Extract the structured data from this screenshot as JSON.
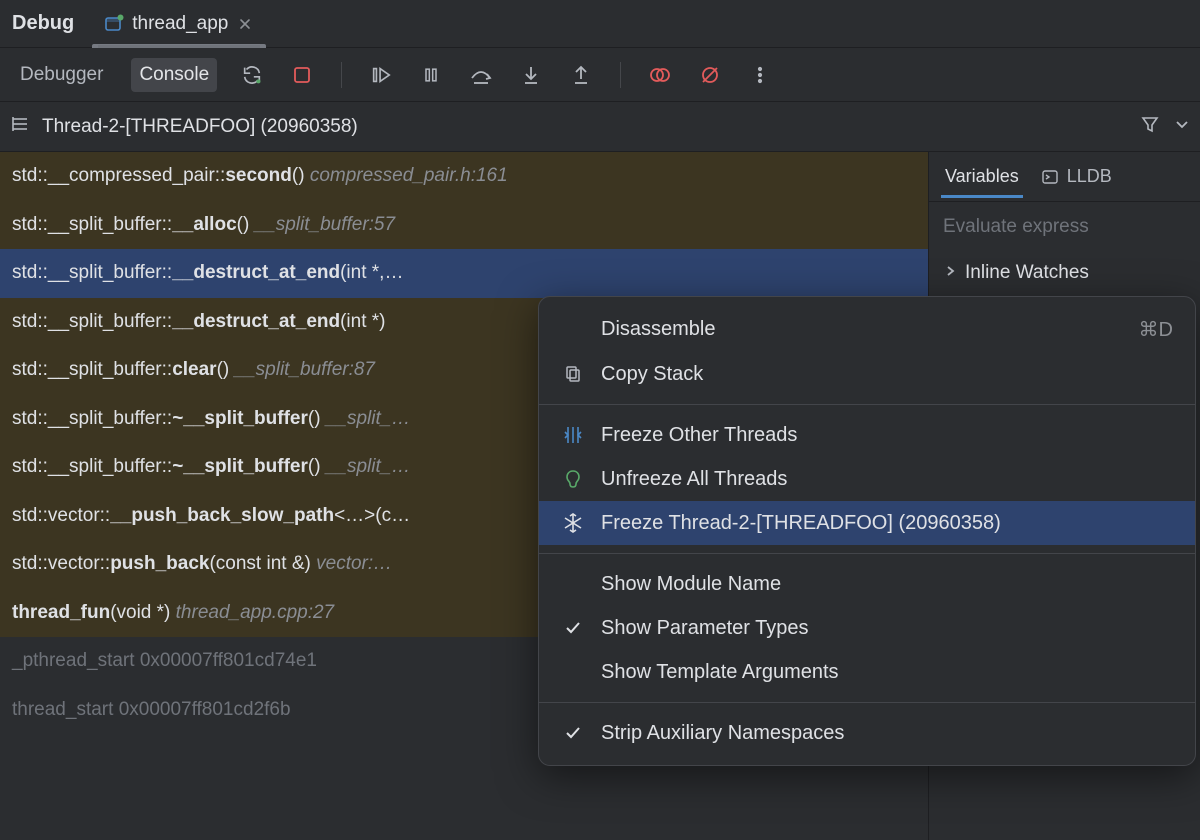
{
  "tabs": {
    "debug_label": "Debug",
    "file_name": "thread_app",
    "close_tooltip": "Close"
  },
  "toolbar": {
    "debugger_label": "Debugger",
    "console_label": "Console"
  },
  "thread_selector": {
    "label": "Thread-2-[THREADFOO] (20960358)"
  },
  "frames": [
    {
      "prefix": "std::__compressed_pair::",
      "fn": "second",
      "args": "()",
      "loc": "compressed_pair.h:161",
      "sys": false,
      "selected": false
    },
    {
      "prefix": "std::__split_buffer::",
      "fn": "__alloc",
      "args": "()",
      "loc": "__split_buffer:57",
      "sys": false,
      "selected": false
    },
    {
      "prefix": "std::__split_buffer::",
      "fn": "__destruct_at_end",
      "args": "(int *,…",
      "loc": "",
      "sys": false,
      "selected": true
    },
    {
      "prefix": "std::__split_buffer::",
      "fn": "__destruct_at_end",
      "args": "(int *)",
      "loc": "",
      "sys": false,
      "selected": false
    },
    {
      "prefix": "std::__split_buffer::",
      "fn": "clear",
      "args": "()",
      "loc": "__split_buffer:87",
      "sys": false,
      "selected": false
    },
    {
      "prefix": "std::__split_buffer::",
      "fn": "~__split_buffer",
      "args": "()",
      "loc": "__split_…",
      "sys": false,
      "selected": false
    },
    {
      "prefix": "std::__split_buffer::",
      "fn": "~__split_buffer",
      "args": "()",
      "loc": "__split_…",
      "sys": false,
      "selected": false
    },
    {
      "prefix": "std::vector::",
      "fn": "__push_back_slow_path",
      "args": "<…>(c…",
      "loc": "",
      "sys": false,
      "selected": false
    },
    {
      "prefix": "std::vector::",
      "fn": "push_back",
      "args": "(const int &)",
      "loc": "vector:…",
      "sys": false,
      "selected": false
    },
    {
      "prefix": "",
      "fn": "thread_fun",
      "args": "(void *)",
      "loc": "thread_app.cpp:27",
      "sys": false,
      "selected": false
    },
    {
      "prefix": "",
      "fn": "_pthread_start",
      "args": "",
      "loc": "0x00007ff801cd74e1",
      "sys": true,
      "selected": false
    },
    {
      "prefix": "",
      "fn": "thread_start",
      "args": "",
      "loc": "0x00007ff801cd2f6b",
      "sys": true,
      "selected": false
    }
  ],
  "vars_panel": {
    "tab_variables": "Variables",
    "tab_lldb": "LLDB",
    "eval_placeholder": "Evaluate express",
    "inline_watches": "Inline Watches"
  },
  "context_menu": {
    "items": [
      {
        "kind": "item",
        "label": "Disassemble",
        "icon": "",
        "shortcut": "⌘D",
        "selected": false
      },
      {
        "kind": "item",
        "label": "Copy Stack",
        "icon": "copy",
        "shortcut": "",
        "selected": false
      },
      {
        "kind": "sep"
      },
      {
        "kind": "item",
        "label": "Freeze Other Threads",
        "icon": "freeze-others",
        "shortcut": "",
        "selected": false
      },
      {
        "kind": "item",
        "label": "Unfreeze All Threads",
        "icon": "unfreeze",
        "shortcut": "",
        "selected": false
      },
      {
        "kind": "item",
        "label": "Freeze Thread-2-[THREADFOO] (20960358)",
        "icon": "snowflake",
        "shortcut": "",
        "selected": true
      },
      {
        "kind": "sep"
      },
      {
        "kind": "item",
        "label": "Show Module Name",
        "icon": "",
        "shortcut": "",
        "selected": false
      },
      {
        "kind": "item",
        "label": "Show Parameter Types",
        "icon": "check",
        "shortcut": "",
        "selected": false
      },
      {
        "kind": "item",
        "label": "Show Template Arguments",
        "icon": "",
        "shortcut": "",
        "selected": false
      },
      {
        "kind": "sep"
      },
      {
        "kind": "item",
        "label": "Strip Auxiliary Namespaces",
        "icon": "check",
        "shortcut": "",
        "selected": false
      }
    ]
  }
}
